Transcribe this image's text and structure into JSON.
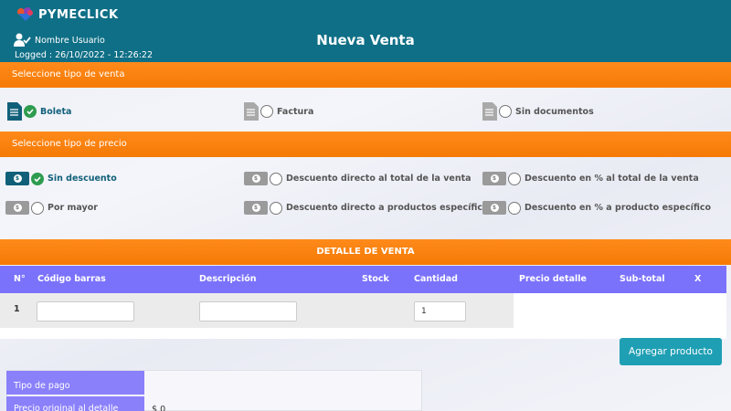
{
  "brand": {
    "name": "PYMECLICK"
  },
  "header": {
    "user_name": "Nombre Usuario",
    "logged": "Logged : 26/10/2022 - 12:26:22",
    "title": "Nueva Venta"
  },
  "sale_type": {
    "heading": "Seleccione tipo de venta",
    "options": [
      {
        "label": "Boleta",
        "selected": true
      },
      {
        "label": "Factura",
        "selected": false
      },
      {
        "label": "Sin documentos",
        "selected": false
      }
    ]
  },
  "price_type": {
    "heading": "Seleccione tipo de precio",
    "options": [
      {
        "label": "Sin descuento",
        "selected": true
      },
      {
        "label": "Descuento directo al total de la venta",
        "selected": false
      },
      {
        "label": "Descuento en % al total de la venta",
        "selected": false
      },
      {
        "label": "Por mayor",
        "selected": false
      },
      {
        "label": "Descuento directo a productos específicos",
        "selected": false
      },
      {
        "label": "Descuento en % a producto específico",
        "selected": false
      }
    ]
  },
  "detail": {
    "heading": "DETALLE DE VENTA",
    "columns": [
      "N°",
      "Código barras",
      "Descripción",
      "Stock",
      "Cantidad",
      "Precio detalle",
      "Sub-total",
      "X"
    ],
    "rows": [
      {
        "num": "1",
        "barcode": "",
        "description": "",
        "quantity": "1"
      }
    ]
  },
  "add_button": "Agregar producto",
  "payment": {
    "type_label": "Tipo de pago",
    "original_label": "Precio original al detalle",
    "original_value": "$ 0"
  },
  "colors": {
    "header": "#0f6f86",
    "orange": "#f57a05",
    "table_header": "#7b72fb",
    "selected": "#2e9c4f",
    "button": "#1f9fb4"
  }
}
